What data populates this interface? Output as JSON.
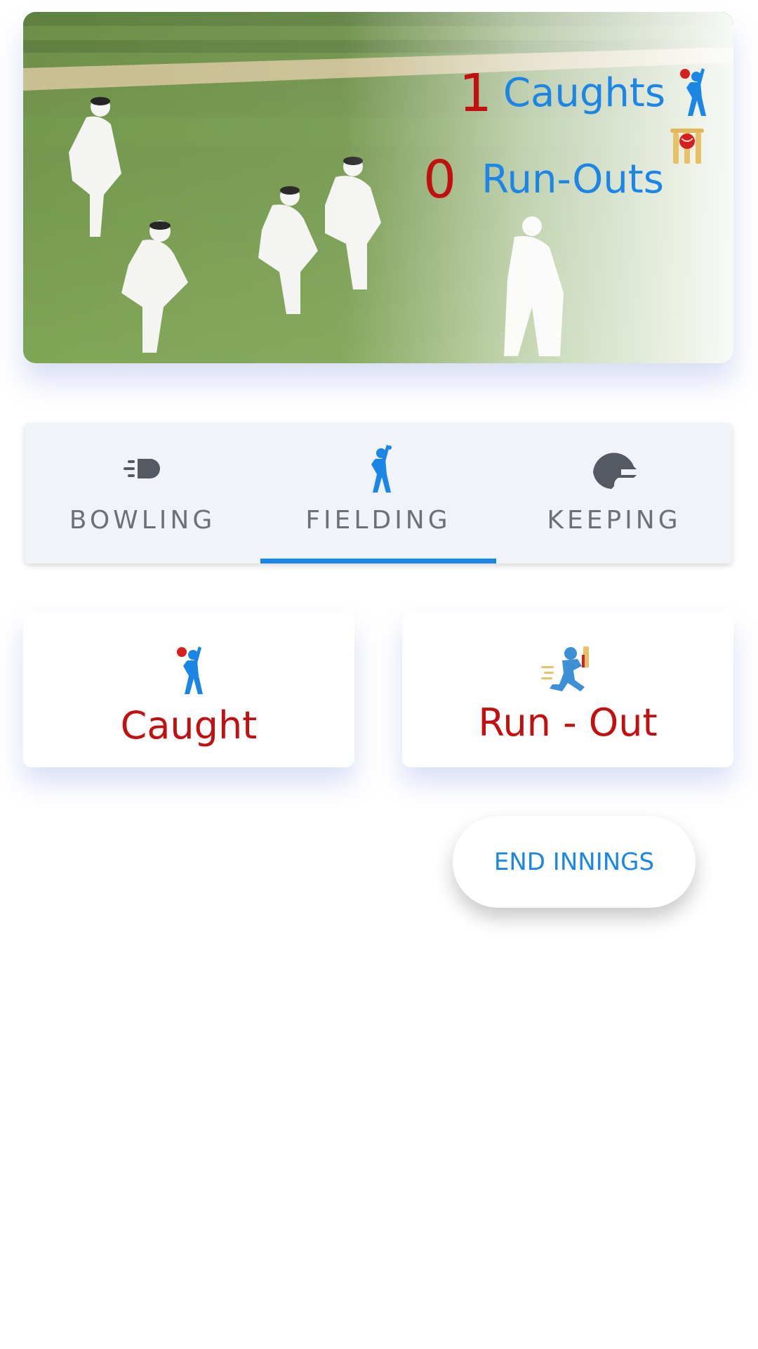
{
  "hero": {
    "image_alt": "cricket-fielders-photo",
    "caught": {
      "count": "1",
      "label": "Caughts",
      "icon": "catching-player-icon"
    },
    "runout": {
      "count": "0",
      "label": "Run-Outs",
      "icon": "stumps-icon"
    }
  },
  "tabs": [
    {
      "label": "BOWLING",
      "icon": "bowling-ball-speed-icon",
      "active": false
    },
    {
      "label": "FIELDING",
      "icon": "fielder-icon",
      "active": true
    },
    {
      "label": "KEEPING",
      "icon": "helmet-icon",
      "active": false
    }
  ],
  "actions": {
    "caught": {
      "label": "Caught",
      "icon": "catching-player-icon"
    },
    "runout": {
      "label": "Run - Out",
      "icon": "running-batsman-icon"
    }
  },
  "end_innings": {
    "label": "END INNINGS"
  },
  "colors": {
    "accent_blue": "#1b86e6",
    "count_red": "#c21010",
    "tab_text": "#6e7079",
    "tab_bg": "#f0f4f9"
  }
}
